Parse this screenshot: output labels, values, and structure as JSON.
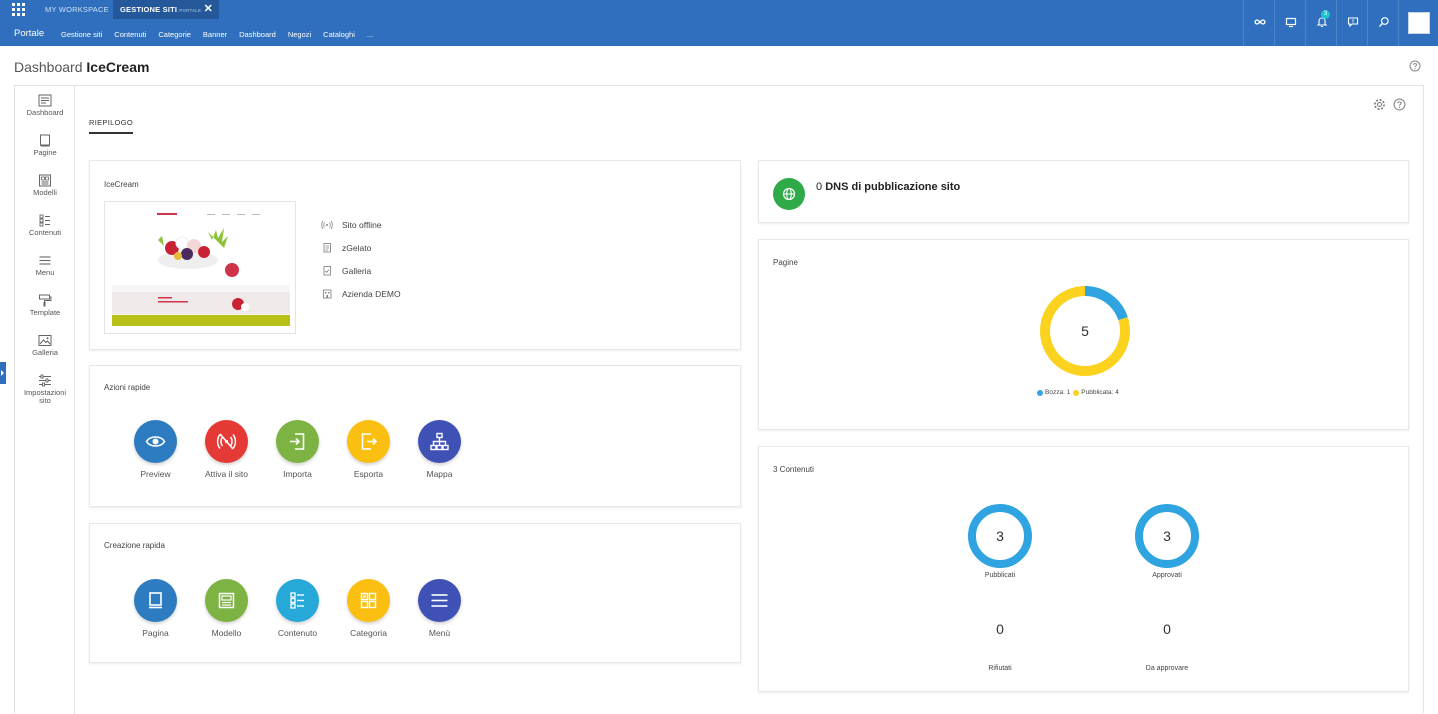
{
  "topbar": {
    "workspace_tab": "MY WORKSPACE",
    "active_tab": "GESTIONE SITI",
    "active_tab_sub": "PORTALE",
    "close_glyph": "✕",
    "notification_count": "3"
  },
  "nav": {
    "brand": "Portale",
    "items": [
      "Gestione siti",
      "Contenuti",
      "Categorie",
      "Banner",
      "Dashboard",
      "Negozi",
      "Cataloghi",
      "..."
    ]
  },
  "page": {
    "title_prefix": "Dashboard",
    "title_name": "IceCream"
  },
  "sidebar": {
    "items": [
      "Dashboard",
      "Pagine",
      "Modelli",
      "Contenuti",
      "Menu",
      "Template",
      "Galleria",
      "Impostazioni",
      "sito"
    ]
  },
  "tabs": {
    "active": "RIEPILOGO"
  },
  "site_card": {
    "title": "IceCream",
    "info": [
      "Sito offline",
      "zGelato",
      "Galleria",
      "Azienda DEMO"
    ]
  },
  "quick_actions": {
    "title": "Azioni rapide",
    "items": [
      "Preview",
      "Attiva il sito",
      "Importa",
      "Esporta",
      "Mappa"
    ]
  },
  "quick_create": {
    "title": "Creazione rapida",
    "items": [
      "Pagina",
      "Modello",
      "Contenuto",
      "Categoria",
      "Menù"
    ]
  },
  "dns": {
    "count": "0",
    "label": "DNS di pubblicazione sito"
  },
  "pages_card": {
    "title": "Pagine",
    "total": "5",
    "legend": [
      {
        "label": "Bozza: 1",
        "value": 1,
        "color": "#2fa4e0"
      },
      {
        "label": "Pubblicata: 4",
        "value": 4,
        "color": "#fbd21d"
      }
    ]
  },
  "contents_card": {
    "title": "3 Contenuti",
    "published_value": "3",
    "published_label": "Pubblicati",
    "approved_value": "3",
    "approved_label": "Approvati",
    "rejected_value": "0",
    "rejected_label": "Rifiutati",
    "pending_value": "0",
    "pending_label": "Da approvare"
  },
  "colors": {
    "brand": "#2f6fbd",
    "preview": "#2d7cc1",
    "activate": "#e53935",
    "import": "#7cb342",
    "export": "#fbbf12",
    "map": "#3f51b5",
    "page": "#2d7cc1",
    "model": "#7cb342",
    "content": "#26a9d8",
    "category": "#fbbf12",
    "menu": "#3f51b5",
    "ring": "#2fa4e0"
  }
}
